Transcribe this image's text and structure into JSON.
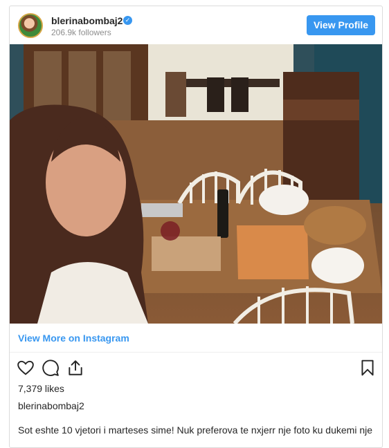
{
  "post": {
    "username": "blerinabombaj2",
    "followers": "206.9k followers",
    "view_profile_label": "View Profile",
    "view_more_label": "View More on Instagram",
    "likes": "7,379 likes",
    "author": "blerinabombaj2",
    "caption": "Sot eshte 10 vjetori i marteses sime! Nuk preferova te nxjerr nje foto ku dukemi nje"
  },
  "icons": {
    "verified": "verified-badge-icon",
    "like": "heart-icon",
    "comment": "comment-bubble-icon",
    "share": "share-icon",
    "save": "bookmark-icon"
  },
  "colors": {
    "accent": "#3897f0",
    "text": "#262626",
    "muted": "#8e8e8e",
    "border": "#dbdbdb"
  }
}
